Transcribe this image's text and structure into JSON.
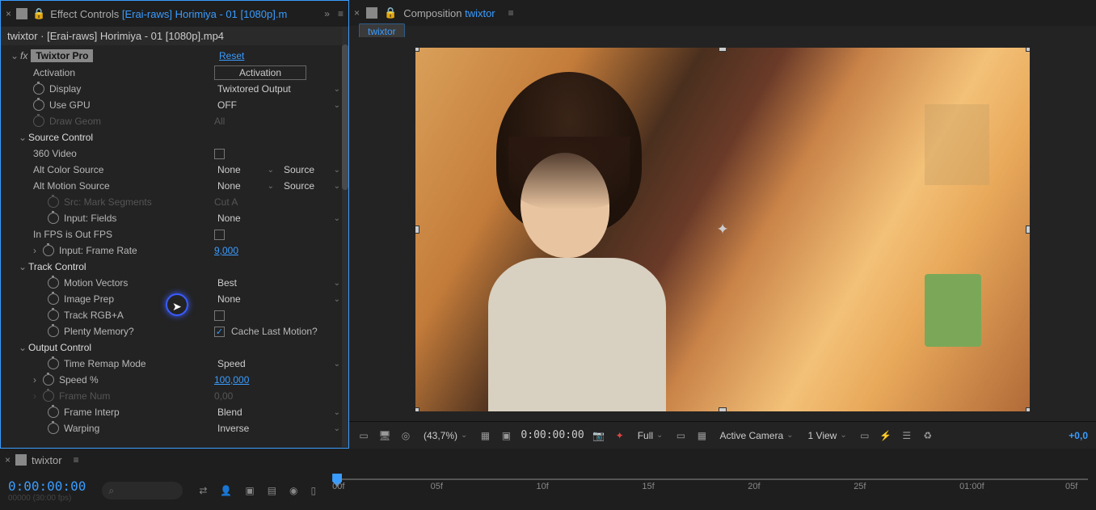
{
  "left": {
    "tab_prefix": "Effect Controls ",
    "tab_file": "[Erai-raws] Horimiya - 01 [1080p].m",
    "breadcrumb": "twixtor · [Erai-raws] Horimiya - 01 [1080p].mp4",
    "fx_name": "Twixtor Pro",
    "reset": "Reset",
    "rows": {
      "activation": "Activation",
      "activation_btn": "Activation",
      "display": "Display",
      "display_val": "Twixtored Output",
      "use_gpu": "Use GPU",
      "use_gpu_val": "OFF",
      "draw_geom": "Draw Geom",
      "draw_geom_val": "All",
      "source_control": "Source Control",
      "video_360": "360 Video",
      "alt_color": "Alt Color Source",
      "alt_color_v1": "None",
      "alt_color_v2": "Source",
      "alt_motion": "Alt Motion Source",
      "alt_motion_v1": "None",
      "alt_motion_v2": "Source",
      "src_mark": "Src: Mark Segments",
      "src_mark_val": "Cut A",
      "input_fields": "Input: Fields",
      "input_fields_val": "None",
      "in_fps": "In FPS is Out FPS",
      "input_rate": "Input: Frame Rate",
      "input_rate_val": "9,000",
      "track_control": "Track Control",
      "motion_vec": "Motion Vectors",
      "motion_vec_val": "Best",
      "image_prep": "Image Prep",
      "image_prep_val": "None",
      "track_rgba": "Track RGB+A",
      "plenty_mem": "Plenty Memory?",
      "cache_last": "Cache Last Motion?",
      "output_control": "Output Control",
      "time_remap": "Time Remap Mode",
      "time_remap_val": "Speed",
      "speed": "Speed %",
      "speed_val": "100,000",
      "frame_num": "Frame Num",
      "frame_num_val": "0,00",
      "frame_interp": "Frame Interp",
      "frame_interp_val": "Blend",
      "warping": "Warping",
      "warping_val": "Inverse"
    }
  },
  "right": {
    "tab_prefix": "Composition ",
    "tab_name": "twixtor",
    "comp_tab": "twixtor",
    "bar": {
      "zoom": "(43,7%)",
      "time": "0:00:00:00",
      "res": "Full",
      "camera": "Active Camera",
      "view": "1 View",
      "exposure": "+0,0"
    }
  },
  "bottom": {
    "tab": "twixtor",
    "timecode": "0:00:00:00",
    "timecode_sub": "00000 (30:00 fps)",
    "ticks": [
      "00f",
      "05f",
      "10f",
      "15f",
      "20f",
      "25f",
      "01:00f",
      "05f"
    ]
  }
}
